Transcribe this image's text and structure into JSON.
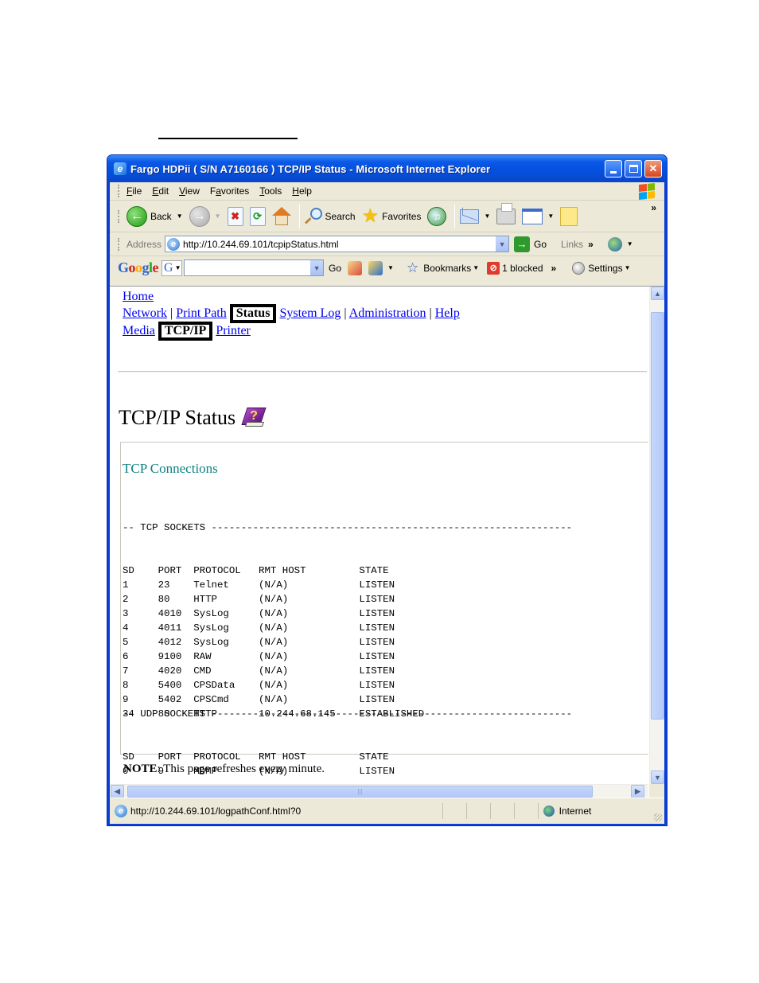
{
  "window": {
    "title": "Fargo HDPii ( S/N A7160166 ) TCP/IP Status - Microsoft Internet Explorer",
    "controls": [
      "minimize",
      "maximize",
      "close"
    ]
  },
  "menubar": {
    "items": [
      {
        "label": "File",
        "accel": "F"
      },
      {
        "label": "Edit",
        "accel": "E"
      },
      {
        "label": "View",
        "accel": "V"
      },
      {
        "label": "Favorites",
        "accel": "a"
      },
      {
        "label": "Tools",
        "accel": "T"
      },
      {
        "label": "Help",
        "accel": "H"
      }
    ]
  },
  "toolbar": {
    "back_label": "Back",
    "search_label": "Search",
    "favorites_label": "Favorites",
    "more": "»"
  },
  "addressbar": {
    "label": "Address",
    "url": "http://10.244.69.101/tcpipStatus.html",
    "go_label": "Go",
    "links_label": "Links",
    "more": "»"
  },
  "googlebar": {
    "logo": [
      "G",
      "o",
      "o",
      "g",
      "l",
      "e"
    ],
    "g_menu": "G",
    "search_value": "",
    "go_label": "Go",
    "bookmarks_label": "Bookmarks",
    "blocked_label": "1 blocked",
    "more": "»",
    "settings_label": "Settings"
  },
  "page": {
    "nav": {
      "home": "Home",
      "row1": [
        {
          "label": "Network",
          "current": false
        },
        {
          "label": "Print Path",
          "current": false
        },
        {
          "label": "Status",
          "current": true
        },
        {
          "label": "System Log",
          "current": false
        },
        {
          "label": "Administration",
          "current": false
        },
        {
          "label": "Help",
          "current": false
        }
      ],
      "row2": [
        {
          "label": "Media",
          "current": false
        },
        {
          "label": "TCP/IP",
          "current": true
        },
        {
          "label": "Printer",
          "current": false
        }
      ],
      "separator": "|"
    },
    "heading": "TCP/IP Status",
    "section_title": "TCP Connections",
    "tcp": {
      "header_line": "-- TCP SOCKETS -------------------------------------------------------------",
      "columns": [
        "SD",
        "PORT",
        "PROTOCOL",
        "RMT HOST",
        "STATE"
      ],
      "rows": [
        [
          "1",
          "23",
          "Telnet",
          "(N/A)",
          "LISTEN"
        ],
        [
          "2",
          "80",
          "HTTP",
          "(N/A)",
          "LISTEN"
        ],
        [
          "3",
          "4010",
          "SysLog",
          "(N/A)",
          "LISTEN"
        ],
        [
          "4",
          "4011",
          "SysLog",
          "(N/A)",
          "LISTEN"
        ],
        [
          "5",
          "4012",
          "SysLog",
          "(N/A)",
          "LISTEN"
        ],
        [
          "6",
          "9100",
          "RAW",
          "(N/A)",
          "LISTEN"
        ],
        [
          "7",
          "4020",
          "CMD",
          "(N/A)",
          "LISTEN"
        ],
        [
          "8",
          "5400",
          "CPSData",
          "(N/A)",
          "LISTEN"
        ],
        [
          "9",
          "5402",
          "CPSCmd",
          "(N/A)",
          "LISTEN"
        ],
        [
          "34",
          "80",
          "HTTP",
          "10.244.68.145",
          "ESTABLISHED"
        ]
      ]
    },
    "udp": {
      "header_line": "-- UDP SOCKETS -------------------------------------------------------------",
      "columns": [
        "SD",
        "PORT",
        "PROTOCOL",
        "RMT HOST",
        "STATE"
      ],
      "rows": [
        [
          "0",
          "9",
          "MDMP",
          "(N/A)",
          "LISTEN"
        ]
      ]
    },
    "note_label": "NOTE",
    "note_text": ": This page refreshes every minute."
  },
  "statusbar": {
    "url": "http://10.244.69.101/logpathConf.html?0",
    "zone": "Internet"
  }
}
